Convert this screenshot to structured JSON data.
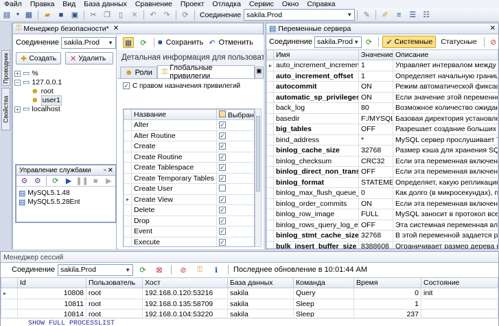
{
  "menu": [
    "Файл",
    "Правка",
    "Вид",
    "База данных",
    "Сравнение",
    "Проект",
    "Отладка",
    "Сервис",
    "Окно",
    "Справка"
  ],
  "toolbar": {
    "connection_label": "Соединение",
    "connection_value": "sakila.Prod"
  },
  "side_tabs": [
    "Проводник",
    "Свойства"
  ],
  "security": {
    "title": "Менеджер безопасности*",
    "connection_label": "Соединение",
    "connection_value": "sakila.Prod",
    "create_label": "Создать",
    "delete_label": "Удалить",
    "tree": [
      "%",
      "127.0.0.1",
      "root",
      "user1",
      "localhost"
    ],
    "save_label": "Сохранить",
    "cancel_label": "Отменить",
    "detail_title": "Детальная информация для пользователя user",
    "tabs": [
      "Роли",
      "Глобальные привилегии"
    ],
    "grant_option_label": "С правом назначения привилегий",
    "col_name": "Название",
    "col_selected": "Выбранные",
    "privileges": [
      {
        "name": "Alter",
        "checked": true
      },
      {
        "name": "Alter Routine",
        "checked": true
      },
      {
        "name": "Create",
        "checked": true
      },
      {
        "name": "Create Routine",
        "checked": true
      },
      {
        "name": "Create Tablespace",
        "checked": true
      },
      {
        "name": "Create Temporary Tables",
        "checked": true
      },
      {
        "name": "Create User",
        "checked": false
      },
      {
        "name": "Create View",
        "checked": true
      },
      {
        "name": "Delete",
        "checked": true
      },
      {
        "name": "Drop",
        "checked": true
      },
      {
        "name": "Event",
        "checked": true
      },
      {
        "name": "Execute",
        "checked": true
      }
    ]
  },
  "service": {
    "title": "Управление службами",
    "items": [
      "MySQL5.1.48",
      "MySQL5.5.28Ent"
    ]
  },
  "server_vars": {
    "title": "Переменные сервера",
    "connection_label": "Соединение",
    "connection_value": "sakila.Prod",
    "system_tab": "Системные",
    "status_tab": "Статусные",
    "col_name": "Имя",
    "col_value": "Значение",
    "col_desc": "Описание",
    "rows": [
      {
        "name": "auto_increment_increment",
        "value": "1",
        "desc": "Управляет интервалом между доп...",
        "bold": false
      },
      {
        "name": "auto_increment_offset",
        "value": "1",
        "desc": "Определяет начальную границу з...",
        "bold": true
      },
      {
        "name": "autocommit",
        "value": "ON",
        "desc": "Режим автоматической фиксации...",
        "bold": true
      },
      {
        "name": "automatic_sp_privileges",
        "value": "ON",
        "desc": "Если значение этой переменной р...",
        "bold": true
      },
      {
        "name": "back_log",
        "value": "80",
        "desc": "Возможное количество ожидающ...",
        "bold": false
      },
      {
        "name": "basedir",
        "value": "F:/MYSQL...",
        "desc": "Базовая директория установлен...",
        "bold": false
      },
      {
        "name": "big_tables",
        "value": "OFF",
        "desc": "Разрешает создание больших ре...",
        "bold": true
      },
      {
        "name": "bind_address",
        "value": "*",
        "desc": "MySQL сервер прослушивает TCP/...",
        "bold": false
      },
      {
        "name": "binlog_cache_size",
        "value": "32768",
        "desc": "Размер кэша для хранения SQL вы...",
        "bold": true
      },
      {
        "name": "binlog_checksum",
        "value": "CRC32",
        "desc": "Если эта переменная включена, т...",
        "bold": false
      },
      {
        "name": "binlog_direct_non_transac...",
        "value": "OFF",
        "desc": "Если эта переменная включена, т...",
        "bold": true
      },
      {
        "name": "binlog_format",
        "value": "STATEMENT",
        "desc": "Определяет, какую репликацию ...",
        "bold": true
      },
      {
        "name": "binlog_max_flush_queue_time",
        "value": "0",
        "desc": "Как долго (в микросекундах), про...",
        "bold": false
      },
      {
        "name": "binlog_order_commits",
        "value": "ON",
        "desc": "Если эта переменная включена, т...",
        "bold": false
      },
      {
        "name": "binlog_row_image",
        "value": "FULL",
        "desc": "MySQL заносит в протокол все стр...",
        "bold": false
      },
      {
        "name": "binlog_rows_query_log_events",
        "value": "OFF",
        "desc": "Эта системная переменная влияет...",
        "bold": false
      },
      {
        "name": "binlog_stmt_cache_size",
        "value": "32768",
        "desc": "В этой переменной задается разм...",
        "bold": true
      },
      {
        "name": "bulk_insert_buffer_size",
        "value": "8388608",
        "desc": "Ограничивает размер дерева кэш...",
        "bold": true
      }
    ]
  },
  "sessions": {
    "title": "Менеджер сессий",
    "connection_label": "Соединение",
    "connection_value": "sakila.Prod",
    "last_update": "Последнее обновление в 10:01:44 AM",
    "cols": [
      "Id",
      "Пользователь",
      "Хост",
      "База данных",
      "Команда",
      "Время",
      "Состояние"
    ],
    "rows": [
      [
        "10808",
        "root",
        "192.168.0.120:53216",
        "sakila",
        "Query",
        "0",
        "init"
      ],
      [
        "10811",
        "root",
        "192.168.0.135:58709",
        "sakila",
        "Sleep",
        "1",
        ""
      ],
      [
        "10814",
        "root",
        "192.168.0.104:53220",
        "sakila",
        "Sleep",
        "237",
        ""
      ]
    ],
    "sql": "SHOW FULL PROCESSLIST"
  }
}
